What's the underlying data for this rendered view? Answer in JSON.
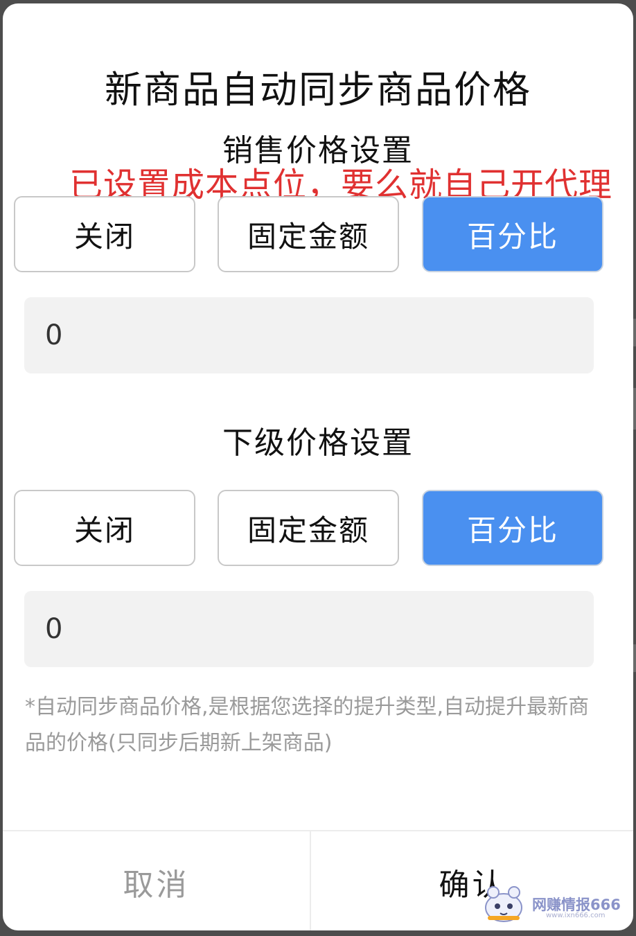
{
  "dialog": {
    "title": "新商品自动同步商品价格",
    "annotation": "已设置成本点位，要么就自己开代理",
    "sale_price": {
      "heading": "销售价格设置",
      "options": [
        "关闭",
        "固定金额",
        "百分比"
      ],
      "selected": "百分比",
      "value": "0"
    },
    "sub_price": {
      "heading": "下级价格设置",
      "options": [
        "关闭",
        "固定金额",
        "百分比"
      ],
      "selected": "百分比",
      "value": "0"
    },
    "note": "*自动同步商品价格,是根据您选择的提升类型,自动提升最新商品的价格(只同步后期新上架商品)",
    "cancel_label": "取消",
    "confirm_label": "确认"
  },
  "watermark": {
    "text": "网赚情报666",
    "sub": "www.ixn666.com"
  },
  "colors": {
    "accent": "#4a90f0",
    "annotation": "#e03131",
    "muted_text": "#9a9a9a",
    "input_bg": "#f2f2f2"
  }
}
